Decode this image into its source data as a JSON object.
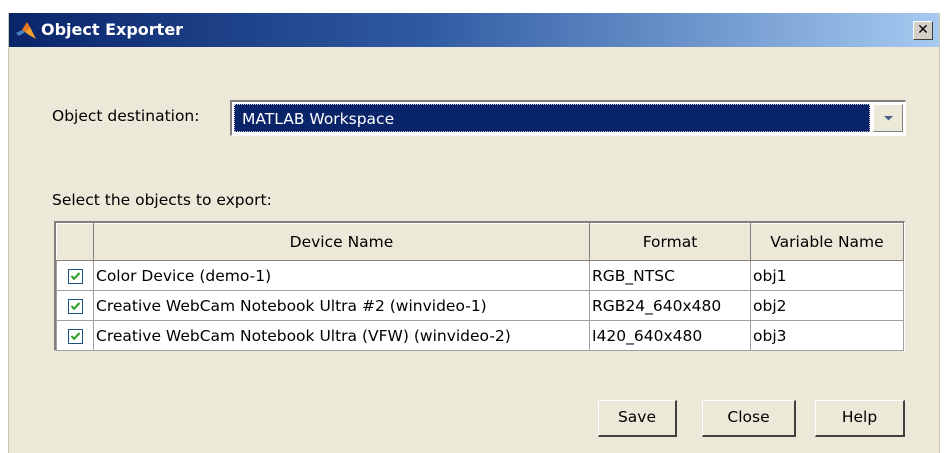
{
  "window": {
    "title": "Object Exporter",
    "close_glyph": "✕"
  },
  "destination": {
    "label": "Object destination:",
    "selected": "MATLAB Workspace"
  },
  "objects": {
    "label": "Select the objects to export:",
    "columns": [
      "",
      "Device Name",
      "Format",
      "Variable Name"
    ],
    "rows": [
      {
        "checked": true,
        "device": "Color Device (demo-1)",
        "format": "RGB_NTSC",
        "variable": "obj1"
      },
      {
        "checked": true,
        "device": "Creative WebCam Notebook Ultra #2 (winvideo-1)",
        "format": "RGB24_640x480",
        "variable": "obj2"
      },
      {
        "checked": true,
        "device": "Creative WebCam Notebook Ultra (VFW) (winvideo-2)",
        "format": "I420_640x480",
        "variable": "obj3"
      }
    ]
  },
  "buttons": {
    "save": "Save",
    "close": "Close",
    "help": "Help"
  },
  "icons": {
    "app": "matlab-logo-icon",
    "close": "close-icon",
    "dropdown": "chevron-down-icon",
    "checkbox": "checkmark-icon"
  },
  "colors": {
    "title_gradient_start": "#0a246a",
    "title_gradient_end": "#a6caf0",
    "selection": "#0a246a",
    "dialog_bg": "#ece9d8"
  }
}
